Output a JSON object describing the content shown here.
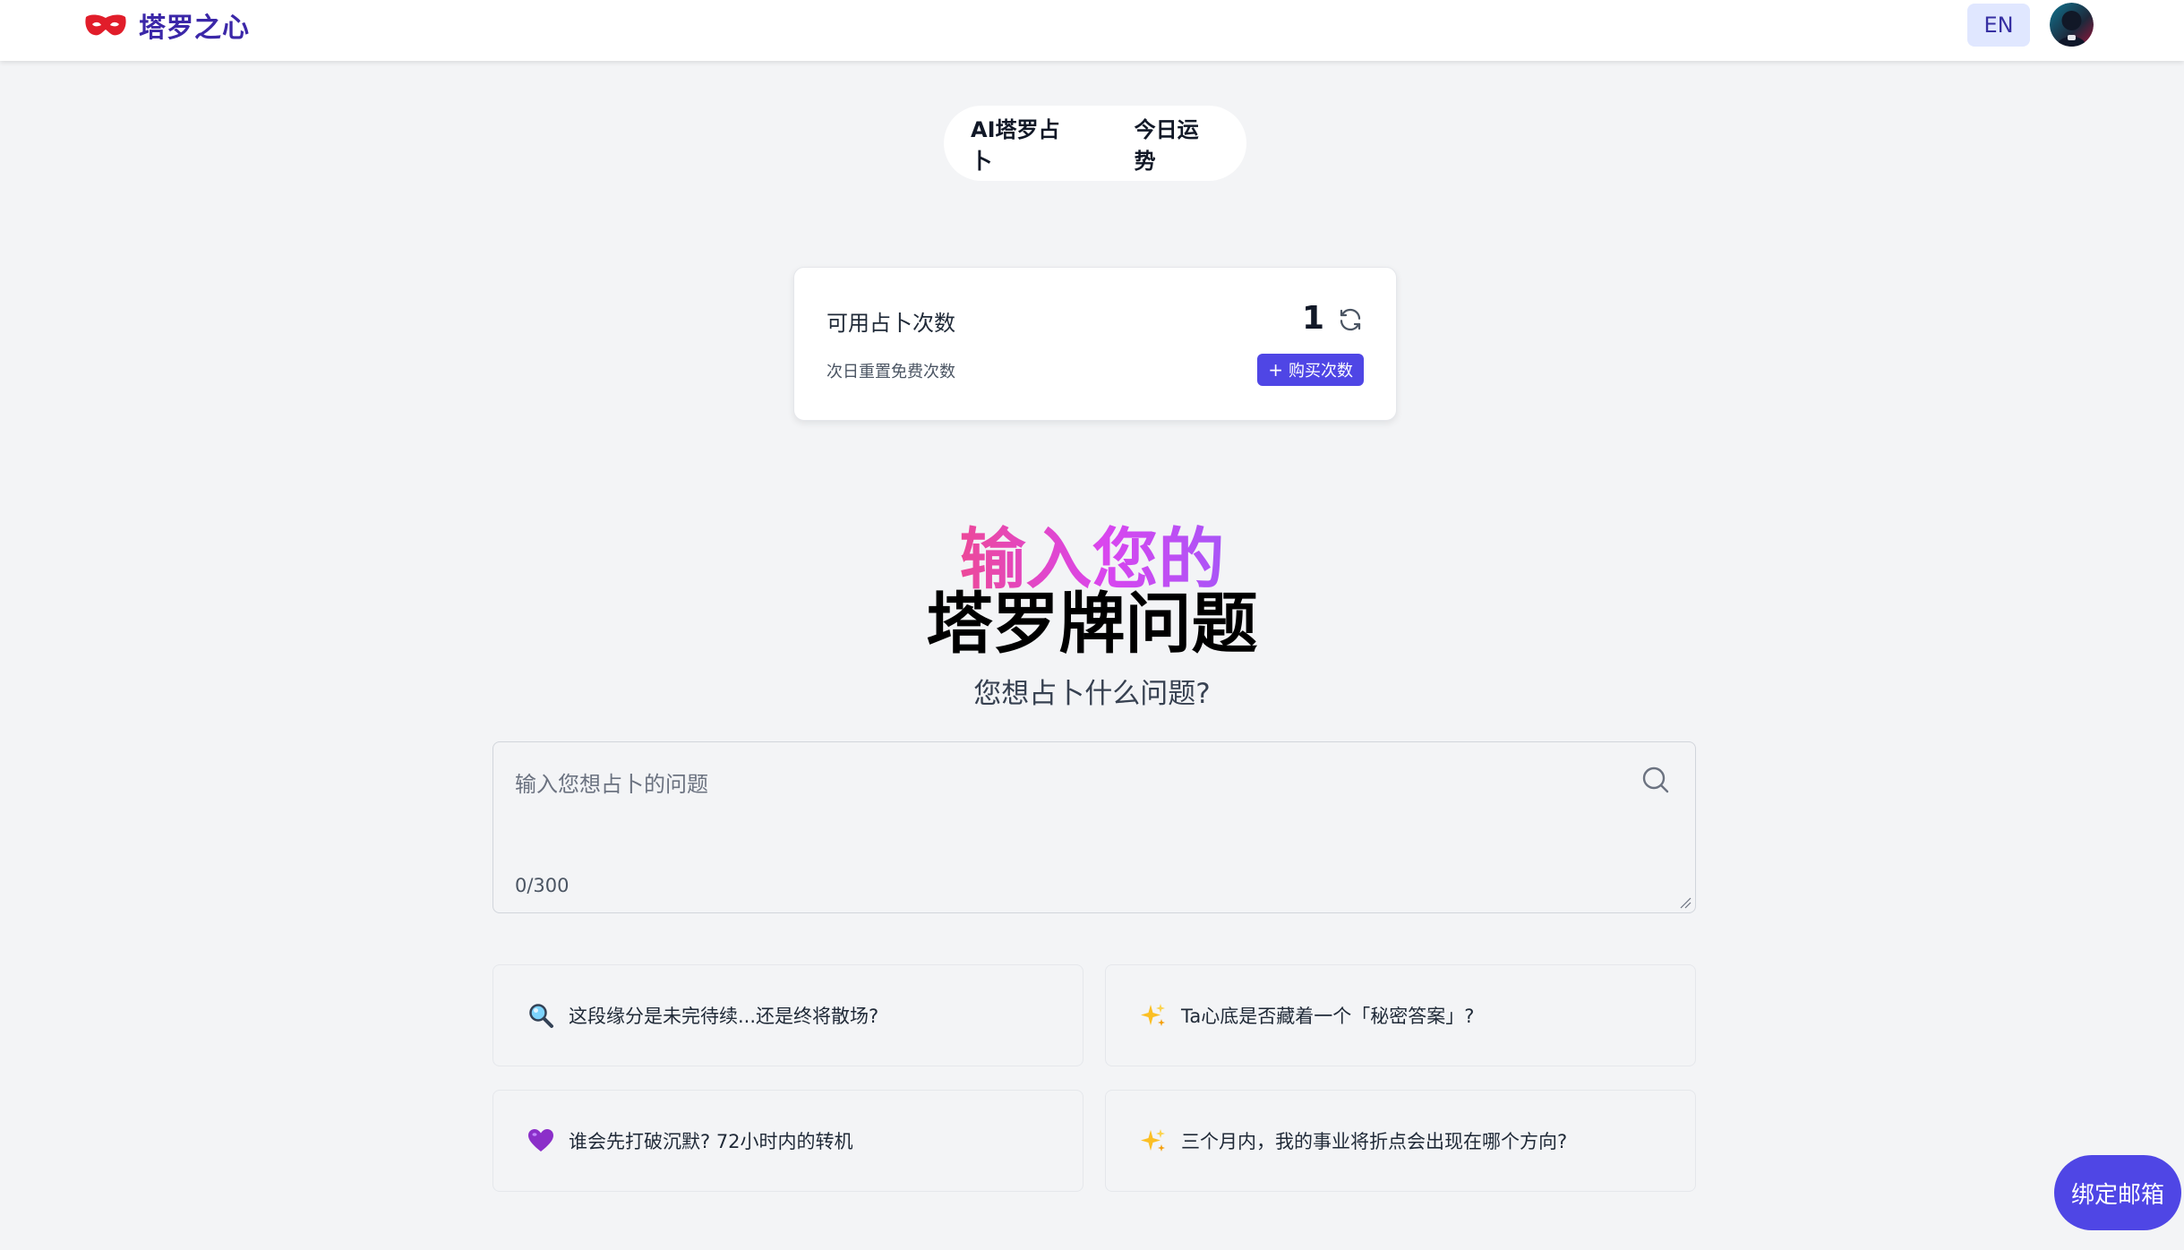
{
  "header": {
    "brand_name": "塔罗之心",
    "lang_label": "EN",
    "brand_color": "#3b27a8",
    "mask_color": "#e11d2a"
  },
  "mode_tabs": [
    {
      "label": "AI塔罗占卜"
    },
    {
      "label": "今日运势"
    }
  ],
  "credits": {
    "label": "可用占卜次数",
    "count": "1",
    "note": "次日重置免费次数",
    "buy_label": "购买次数",
    "buy_plus": "+"
  },
  "hero": {
    "line1": "输入您的",
    "line2": "塔罗牌问题",
    "subtitle": "您想占卜什么问题?"
  },
  "question": {
    "placeholder": "输入您想占卜的问题",
    "value": "",
    "char_count": "0/300"
  },
  "suggestions": [
    {
      "icon": "magnifier-emoji-icon",
      "text": "这段缘分是未完待续...还是终将散场?"
    },
    {
      "icon": "sparkles-emoji-icon",
      "text": "Ta心底是否藏着一个「秘密答案」?"
    },
    {
      "icon": "purple-heart-emoji-icon",
      "text": "谁会先打破沉默? 72小时内的转机"
    },
    {
      "icon": "sparkles-emoji-icon",
      "text": "三个月内，我的事业将折点会出现在哪个方向?"
    }
  ],
  "bind_email": {
    "label": "绑定邮箱"
  },
  "colors": {
    "accent": "#4f46e5",
    "background": "#f3f4f6",
    "gradient_start": "#ec4899",
    "gradient_end": "#a855f7"
  }
}
